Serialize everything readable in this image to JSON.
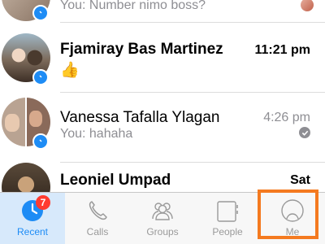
{
  "conversations": [
    {
      "name": "",
      "preview": "You: Number nimo boss?",
      "time": "",
      "unread": false
    },
    {
      "name": "Fjamiray Bas Martinez",
      "preview": "👍",
      "time": "11:21 pm",
      "unread": true
    },
    {
      "name": "Vanessa Tafalla Ylagan",
      "preview": "You: hahaha",
      "time": "4:26 pm",
      "unread": false,
      "seen": true
    },
    {
      "name": "Leoniel Umpad",
      "preview": "",
      "time": "Sat",
      "unread": true
    }
  ],
  "tabbar": {
    "tabs": [
      {
        "label": "Recent",
        "icon": "clock-icon",
        "badge": "7",
        "active": true
      },
      {
        "label": "Calls",
        "icon": "phone-icon",
        "active": false
      },
      {
        "label": "Groups",
        "icon": "groups-icon",
        "active": false
      },
      {
        "label": "People",
        "icon": "people-icon",
        "active": false
      },
      {
        "label": "Me",
        "icon": "me-icon",
        "active": false
      }
    ]
  },
  "colors": {
    "accent": "#1e8cf5",
    "badge": "#ff3b30",
    "highlight": "#f47a20"
  }
}
